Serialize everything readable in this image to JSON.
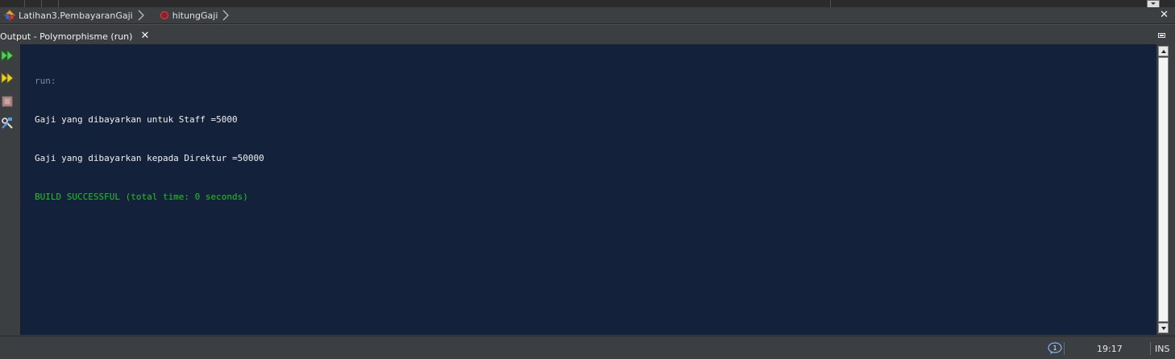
{
  "breadcrumb": {
    "class_name": "Latihan3.PembayaranGaji",
    "method_name": "hitungGaji"
  },
  "output_tab": {
    "label": "Output - Polymorphisme (run)",
    "close_glyph": "✕"
  },
  "toolbar": {
    "icons": [
      "rerun-icon",
      "rerun-with-options-icon",
      "stop-icon",
      "settings-tools-icon"
    ]
  },
  "console": {
    "lines": [
      {
        "text": "run:",
        "style": "muted"
      },
      {
        "text": "Gaji yang dibayarkan untuk Staff =5000",
        "style": "normal"
      },
      {
        "text": "Gaji yang dibayarkan kepada Direktur =50000",
        "style": "normal"
      },
      {
        "text": "BUILD SUCCESSFUL (total time: 0 seconds)",
        "style": "success"
      }
    ]
  },
  "status": {
    "notifications": "1",
    "time": "19:17",
    "mode": "INS"
  },
  "colors": {
    "console_bg": "#13213a",
    "success": "#21c12a",
    "muted": "#7f8a99",
    "panel": "#3c3f41"
  }
}
